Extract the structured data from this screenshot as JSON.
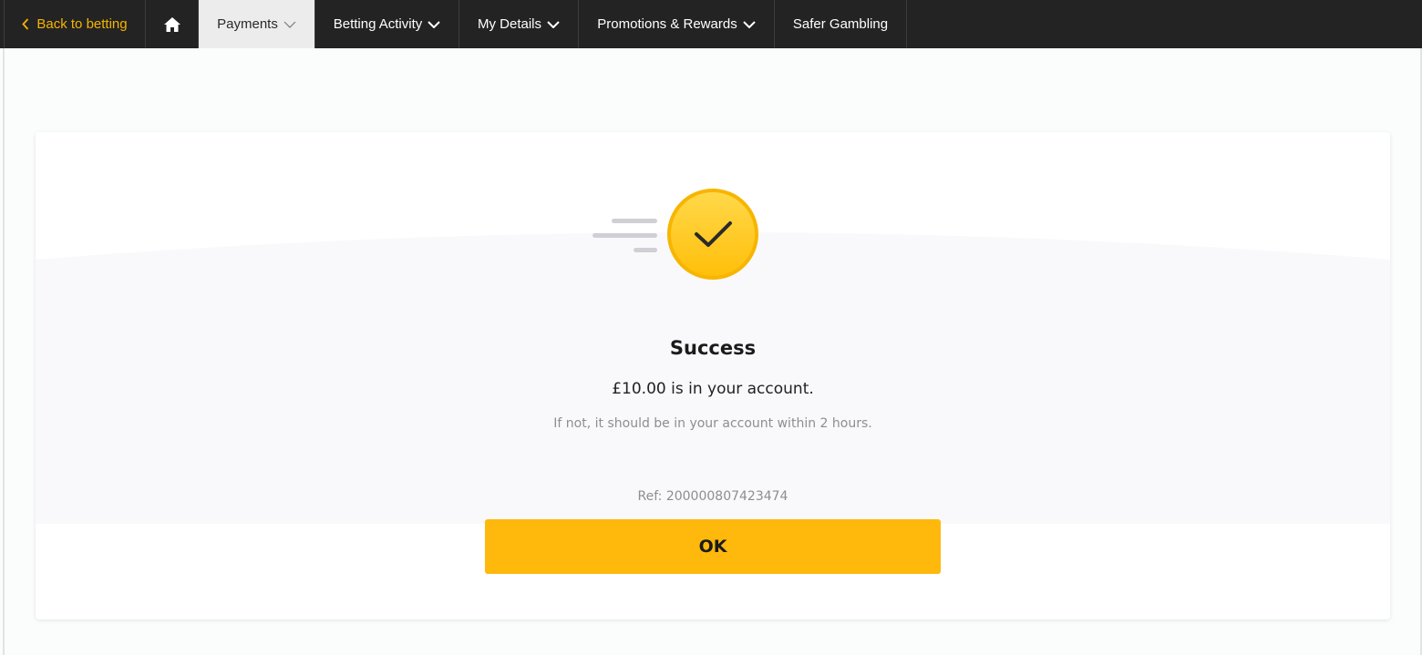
{
  "nav": {
    "back_label": "Back to betting",
    "items": [
      {
        "label": "Payments"
      },
      {
        "label": "Betting Activity"
      },
      {
        "label": "My Details"
      },
      {
        "label": "Promotions & Rewards"
      },
      {
        "label": "Safer Gambling"
      }
    ],
    "home_icon": "home-icon"
  },
  "result": {
    "title": "Success",
    "message": "£10.00 is in your account.",
    "note": "If not, it should be in your account within 2 hours.",
    "reference": "Ref: 200000807423474",
    "ok_label": "OK",
    "status_icon": "check-circle-icon"
  },
  "colors": {
    "accent": "#f5b400",
    "nav_bg": "#232323",
    "button": "#ffb80c"
  }
}
